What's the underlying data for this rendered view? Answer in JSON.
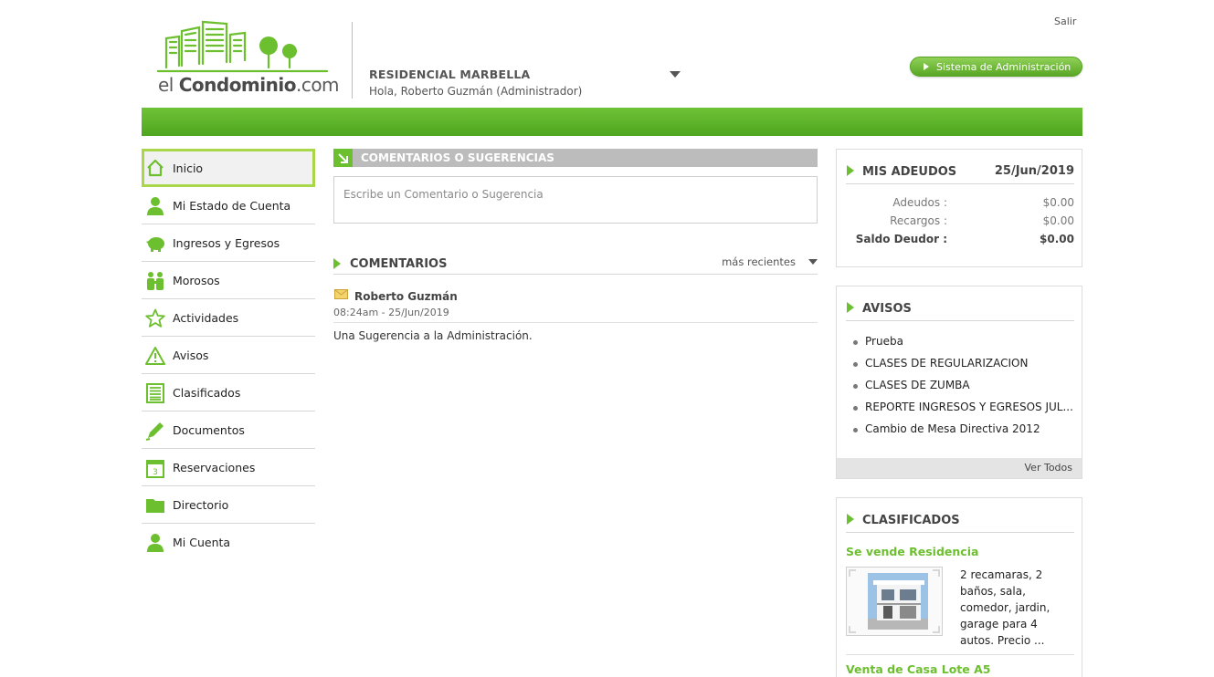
{
  "header": {
    "logo_prefix": "el ",
    "logo_bold": "Condominio",
    "logo_suffix": ".com",
    "residence_name": "RESIDENCIAL MARBELLA",
    "greeting": "Hola, Roberto Guzmán (Administrador)",
    "logout_label": "Salir",
    "admin_button_label": "Sistema de Administración"
  },
  "sidebar": {
    "items": [
      {
        "label": "Inicio",
        "icon": "home-icon",
        "active": true
      },
      {
        "label": "Mi Estado de Cuenta",
        "icon": "user-icon"
      },
      {
        "label": "Ingresos y Egresos",
        "icon": "piggy-bank-icon"
      },
      {
        "label": "Morosos",
        "icon": "people-icon"
      },
      {
        "label": "Actividades",
        "icon": "star-icon"
      },
      {
        "label": "Avisos",
        "icon": "warning-icon"
      },
      {
        "label": "Clasificados",
        "icon": "newspaper-icon"
      },
      {
        "label": "Documentos",
        "icon": "pencil-icon"
      },
      {
        "label": "Reservaciones",
        "icon": "calendar-icon"
      },
      {
        "label": "Directorio",
        "icon": "folder-icon"
      },
      {
        "label": "Mi Cuenta",
        "icon": "user-icon"
      }
    ]
  },
  "comment_form": {
    "title": "COMENTARIOS O SUGERENCIAS",
    "placeholder": "Escribe un Comentario o Sugerencia"
  },
  "comments": {
    "title": "COMENTARIOS",
    "sort_label": "más recientes",
    "items": [
      {
        "author": "Roberto Guzmán",
        "date": "08:24am - 25/Jun/2019",
        "text": "Una Sugerencia a la Administración."
      }
    ]
  },
  "debts": {
    "title": "MIS ADEUDOS",
    "date": "25/Jun/2019",
    "rows": [
      {
        "label": "Adeudos :",
        "value": "$0.00"
      },
      {
        "label": "Recargos :",
        "value": "$0.00"
      },
      {
        "label": "Saldo Deudor :",
        "value": "$0.00"
      }
    ]
  },
  "notices": {
    "title": "AVISOS",
    "items": [
      "Prueba",
      "CLASES DE REGULARIZACION",
      "CLASES DE ZUMBA",
      "REPORTE INGRESOS Y EGRESOS JUL...",
      "Cambio de Mesa Directiva 2012"
    ],
    "see_all_label": "Ver Todos"
  },
  "classifieds": {
    "title": "CLASIFICADOS",
    "items": [
      {
        "title": "Se vende Residencia",
        "description": "2 recamaras, 2 baños, sala, comedor, jardin, garage para 4 autos. Precio ..."
      },
      {
        "title": "Venta de Casa Lote A5"
      }
    ]
  },
  "colors": {
    "brand_green": "#6cbf2e",
    "active_border": "#a8d84a",
    "header_gray": "#bcbcbc"
  }
}
